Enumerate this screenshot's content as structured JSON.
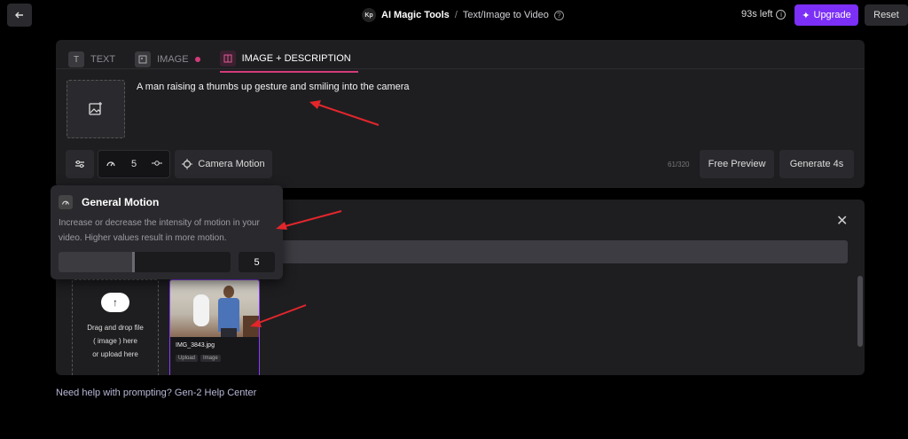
{
  "header": {
    "back_icon": "arrow-left-icon",
    "logo_text": "Kp",
    "app_name": "AI Magic Tools",
    "separator": "/",
    "page_name": "Text/Image to Video",
    "credits": "93s left",
    "upgrade_label": "Upgrade",
    "reset_label": "Reset"
  },
  "tabs": [
    {
      "label": "TEXT",
      "icon": "T",
      "active": false
    },
    {
      "label": "IMAGE",
      "icon": "image-icon",
      "active": false
    },
    {
      "label": "IMAGE + DESCRIPTION",
      "icon": "split-icon",
      "active": true
    }
  ],
  "prompt_text": "A man raising a thumbs up gesture and smiling into the camera",
  "controls": {
    "motion_value": "5",
    "camera_motion_label": "Camera Motion",
    "char_counter": "61/320",
    "free_preview_label": "Free Preview",
    "generate_label": "Generate 4s"
  },
  "popover": {
    "title": "General Motion",
    "description": "Increase or decrease the intensity of motion in your video. Higher values result in more motion.",
    "value": "5",
    "slider_level": 0.44
  },
  "uploads": {
    "dropzone_line1": "Drag and drop file",
    "dropzone_line2": "( image ) here",
    "dropzone_line3": "or upload here",
    "file_name": "IMG_3843.jpg",
    "badge_1": "Upload",
    "badge_2": "Image"
  },
  "help_text": "Need help with prompting? Gen-2 Help Center",
  "colors": {
    "accent": "#7b2ff7",
    "tab_active": "#d23b7a",
    "annotation": "#e3262b"
  }
}
